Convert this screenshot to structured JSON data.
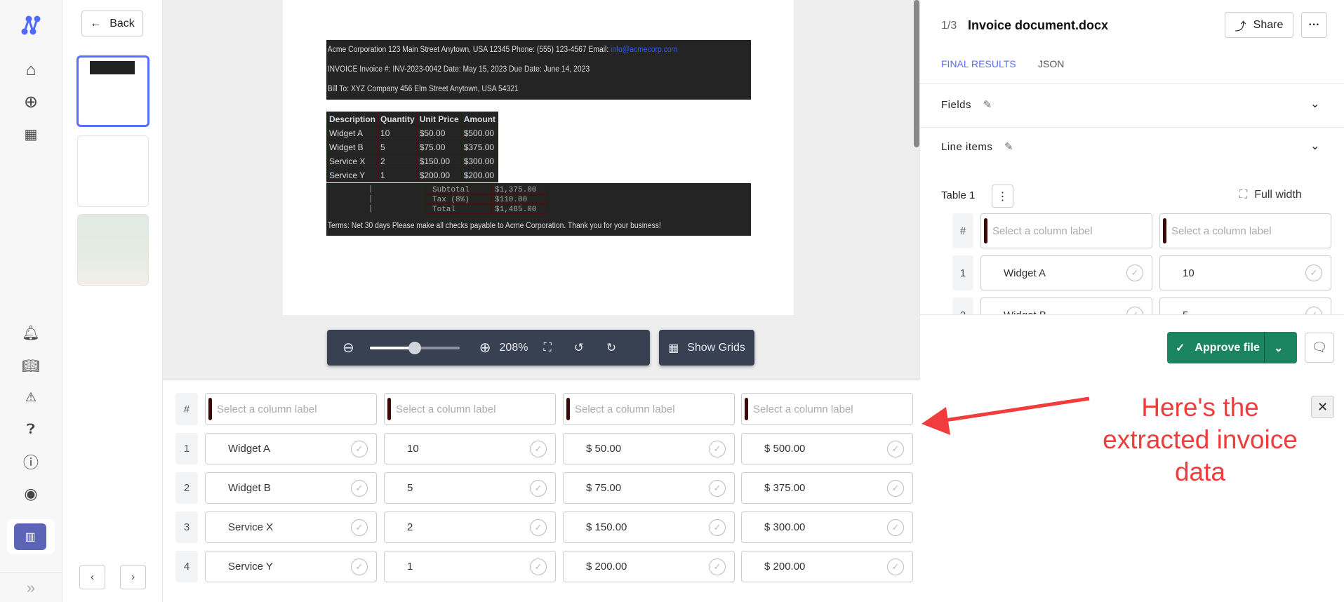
{
  "rail": {
    "icons": [
      "logo-icon",
      "home-icon",
      "add-circle-icon",
      "apps-icon",
      "bell-icon",
      "book-icon",
      "feedback-icon",
      "help-bubble-icon",
      "help-circle-icon",
      "account-icon",
      "building-icon",
      "expand-icon"
    ]
  },
  "thumbs": {
    "back_label": "Back",
    "page_count": 3
  },
  "document": {
    "line1": "Acme Corporation 123 Main Street Anytown, USA 12345 Phone: (555) 123-4567 Email: ",
    "email": "info@acmecorp.com",
    "line2": "INVOICE Invoice #: INV-2023-0042 Date: May 15, 2023 Due Date: June 14, 2023",
    "line3": "Bill To: XYZ Company 456 Elm Street Anytown, USA 54321",
    "headers": [
      "Description",
      "Quantity",
      "Unit Price",
      "Amount"
    ],
    "rows": [
      [
        "Widget A",
        "10",
        "$50.00",
        "$500.00"
      ],
      [
        "Widget B",
        "5",
        "$75.00",
        "$375.00"
      ],
      [
        "Service X",
        "2",
        "$150.00",
        "$300.00"
      ],
      [
        "Service Y",
        "1",
        "$200.00",
        "$200.00"
      ]
    ],
    "totals": [
      [
        "Subtotal",
        "$1,375.00"
      ],
      [
        "Tax (8%)",
        "$110.00"
      ],
      [
        "Total",
        "$1,485.00"
      ]
    ],
    "terms": "Terms: Net 30 days Please make all checks payable to Acme Corporation. Thank you for your business!"
  },
  "toolbar": {
    "zoom": "208%",
    "zoom_slider_percent": 50,
    "show_grids": "Show Grids"
  },
  "right": {
    "page": "1/3",
    "title": "Invoice document.docx",
    "share": "Share",
    "tabs": [
      "FINAL RESULTS",
      "JSON"
    ],
    "fields": "Fields",
    "line_items": "Line items",
    "table": "Table 1",
    "full_width": "Full width",
    "approve": "Approve file",
    "accent": "#5b6cff",
    "approve_color": "#1a8560"
  },
  "grid": {
    "placeholder": "Select a column label",
    "hash": "#",
    "rows": [
      [
        "1",
        "Widget A",
        "10",
        "$ 50.00",
        "$ 500.00"
      ],
      [
        "2",
        "Widget B",
        "5",
        "$ 75.00",
        "$ 375.00"
      ],
      [
        "3",
        "Service X",
        "2",
        "$ 150.00",
        "$ 300.00"
      ],
      [
        "4",
        "Service Y",
        "1",
        "$ 200.00",
        "$ 200.00"
      ]
    ]
  },
  "annotation": {
    "text": "Here's the extracted invoice data",
    "color": "#f03c3c"
  }
}
